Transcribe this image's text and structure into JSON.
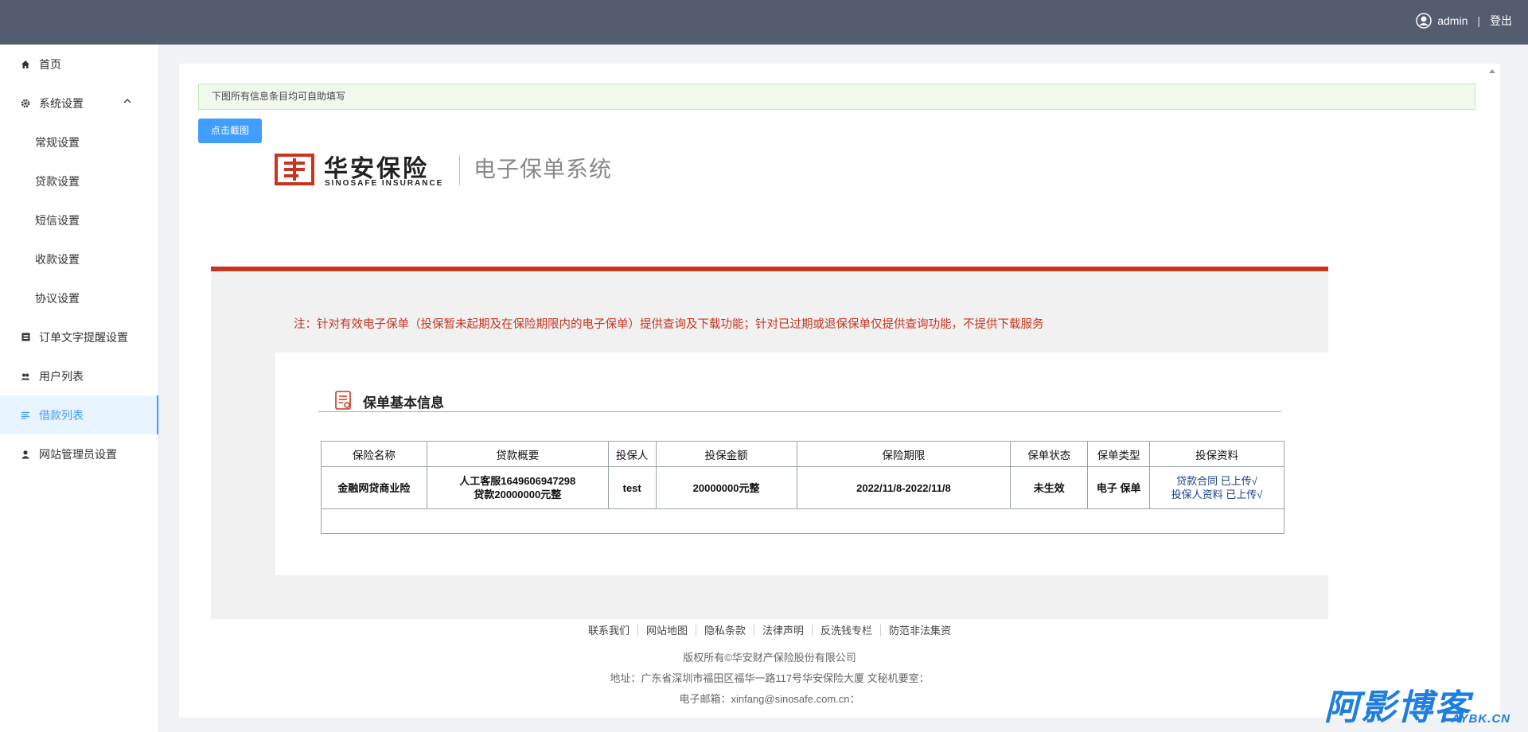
{
  "header": {
    "username": "admin",
    "separator": "|",
    "logout_label": "登出",
    "bg_color": "#545c70"
  },
  "sidebar": {
    "items": [
      {
        "label": "首页",
        "icon": "home-icon"
      },
      {
        "label": "系统设置",
        "icon": "gear-icon",
        "expanded": true
      },
      {
        "label": "常规设置",
        "sub": true
      },
      {
        "label": "贷款设置",
        "sub": true
      },
      {
        "label": "短信设置",
        "sub": true
      },
      {
        "label": "收款设置",
        "sub": true
      },
      {
        "label": "协议设置",
        "sub": true
      },
      {
        "label": "订单文字提醒设置",
        "icon": "list-icon"
      },
      {
        "label": "用户列表",
        "icon": "users-icon"
      },
      {
        "label": "借款列表",
        "icon": "menu-lines-icon",
        "active": true
      },
      {
        "label": "网站管理员设置",
        "icon": "user-icon"
      }
    ],
    "active_color": "#409eff"
  },
  "main": {
    "notice": "下图所有信息条目均可自助填写",
    "screenshot_button": "点击截图"
  },
  "document": {
    "brand_cn": "华安保险",
    "brand_en": "SINOSAFE INSURANCE",
    "system_title": "电子保单系统",
    "warning": "注：针对有效电子保单（投保暂未起期及在保险期限内的电子保单）提供查询及下载功能；针对已过期或退保保单仅提供查询功能，不提供下载服务",
    "section_title": "保单基本信息",
    "table": {
      "headers": [
        "保险名称",
        "贷款概要",
        "投保人",
        "投保金额",
        "保险期限",
        "保单状态",
        "保单类型",
        "投保资料"
      ],
      "row": {
        "name": "金融网贷商业险",
        "summary_line1": "人工客服1649606947298",
        "summary_line2": "贷款20000000元整",
        "insured": "test",
        "amount": "20000000元整",
        "period": "2022/11/8-2022/11/8",
        "status": "未生效",
        "type": "电子 保单",
        "docs_line1": "贷款合同 已上传√",
        "docs_line2": "投保人资料 已上传√"
      }
    },
    "footer_links": [
      "联系我们",
      "网站地图",
      "隐私条款",
      "法律声明",
      "反洗钱专栏",
      "防范非法集资"
    ],
    "copyright": "版权所有©华安财产保险股份有限公司",
    "address": "地址：广东省深圳市福田区福华一路117号华安保险大厦 文秘机要室：",
    "email": "电子邮箱：xinfang@sinosafe.com.cn："
  },
  "watermark": {
    "cn": "阿影博客",
    "en": "AYBK.CN",
    "color": "#1f7fe0"
  }
}
